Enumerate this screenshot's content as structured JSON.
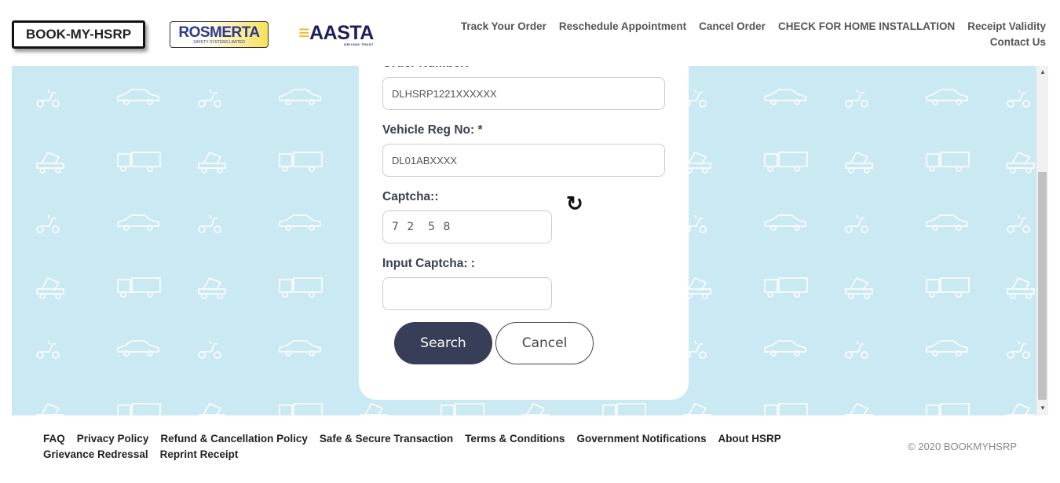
{
  "header": {
    "logos": {
      "bookmyhsrp": "BOOK-MY-HSRP",
      "rosmerta": "ROSMERTA",
      "rosmerta_sub": "SAFETY SYSTEMS LIMITED",
      "aasta": "AASTA",
      "aasta_sub": "DRIVING TRUST"
    },
    "nav": [
      "Track Your Order",
      "Reschedule Appointment",
      "Cancel Order",
      "CHECK FOR HOME INSTALLATION",
      "Receipt Validity",
      "Contact Us"
    ]
  },
  "form": {
    "order_label": "Order Number: *",
    "order_placeholder": "DLHSRP1221XXXXXX",
    "reg_label": "Vehicle Reg No: *",
    "reg_placeholder": "DL01ABXXXX",
    "captcha_label": "Captcha::",
    "captcha_value": "7 2  5 8",
    "input_captcha_label": "Input Captcha: :",
    "input_captcha_value": "",
    "search_label": "Search",
    "cancel_label": "Cancel",
    "refresh_icon": "refresh-icon"
  },
  "footer": {
    "links": [
      "FAQ",
      "Privacy Policy",
      "Refund & Cancellation Policy",
      "Safe & Secure Transaction",
      "Terms & Conditions",
      "Government Notifications",
      "About HSRP",
      "Grievance Redressal",
      "Reprint Receipt"
    ],
    "copyright": "© 2020 BOOKMYHSRP"
  },
  "colors": {
    "background_pattern": "#cbe9f3",
    "primary_button": "#383e57"
  }
}
